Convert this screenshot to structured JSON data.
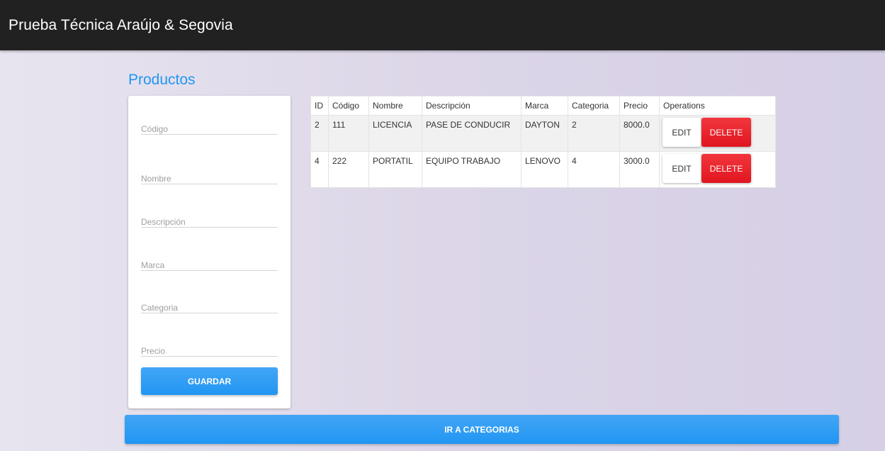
{
  "header": {
    "title": "Prueba Técnica Araújo & Segovia"
  },
  "page": {
    "title": "Productos"
  },
  "form": {
    "fields": [
      {
        "placeholder": "Código",
        "value": ""
      },
      {
        "placeholder": "Nombre",
        "value": ""
      },
      {
        "placeholder": "Descripción",
        "value": ""
      },
      {
        "placeholder": "Marca",
        "value": ""
      },
      {
        "placeholder": "Categoria",
        "value": ""
      },
      {
        "placeholder": "Precio",
        "value": ""
      }
    ],
    "submit_label": "GUARDAR"
  },
  "table": {
    "columns": [
      "ID",
      "Código",
      "Nombre",
      "Descripción",
      "Marca",
      "Categoria",
      "Precio",
      "Operations"
    ],
    "rows": [
      {
        "id": "2",
        "codigo": "111",
        "nombre": "LICENCIA",
        "descripcion": "PASE DE CONDUCIR",
        "marca": "DAYTON",
        "categoria": "2",
        "precio": "8000.0"
      },
      {
        "id": "4",
        "codigo": "222",
        "nombre": "PORTATIL",
        "descripcion": "EQUIPO TRABAJO",
        "marca": "LENOVO",
        "categoria": "4",
        "precio": "3000.0"
      }
    ],
    "edit_label": "EDIT",
    "delete_label": "DELETE"
  },
  "footer": {
    "categorias_label": "IR A CATEGORIAS"
  },
  "colors": {
    "accent": "#2196f3",
    "danger": "#e0161f",
    "navbar": "#212121"
  }
}
